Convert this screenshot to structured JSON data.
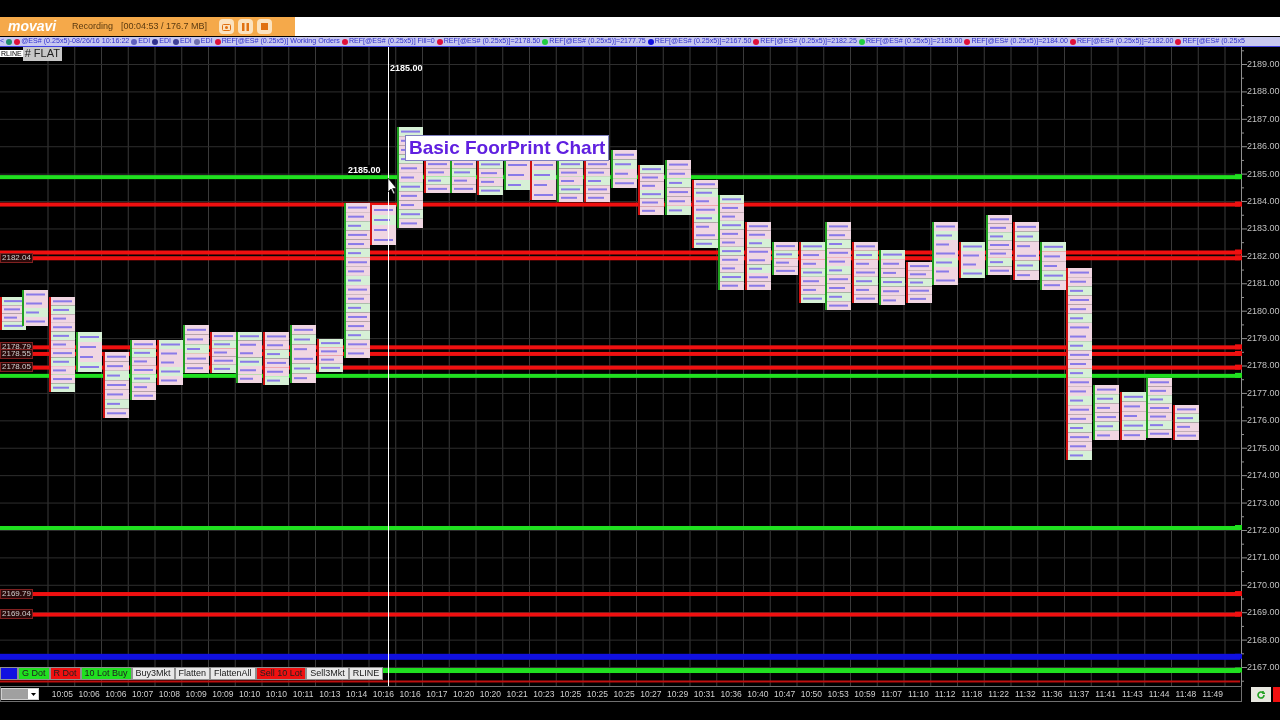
{
  "recorder": {
    "logo": "movavi",
    "status": "Recording",
    "timer": "[00:04:53 / 176.7 MB]"
  },
  "status_strip": {
    "items": [
      {
        "text": "<"
      },
      {
        "color": "#1f8f6f"
      },
      {
        "text": "@ES# (0.25x5)-08/26/16 10:16:22",
        "color": "#e0103a"
      },
      {
        "text": "EDI",
        "color": "#6060c0"
      },
      {
        "text": "EDI",
        "color": "#303090"
      },
      {
        "text": "EDI",
        "color": "#404098"
      },
      {
        "text": "EDI",
        "color": "#7070b0"
      },
      {
        "text": "REF[@ES# (0.25x5)] Working Orders",
        "color": "#e0103a"
      },
      {
        "text": "REF[@ES# (0.25x5)] Fill=0",
        "color": "#e0103a"
      },
      {
        "text": "REF[@ES# (0.25x5)]=2178.50",
        "color": "#e0103a"
      },
      {
        "text": "REF[@ES# (0.25x5)]=2177.75",
        "color": "#20d040"
      },
      {
        "text": "REF[@ES# (0.25x5)]=2167.50",
        "color": "#1010e0"
      },
      {
        "text": "REF[@ES# (0.25x5)]=2182.25",
        "color": "#e0103a"
      },
      {
        "text": "REF[@ES# (0.25x5)]=2185.00",
        "color": "#20d040"
      },
      {
        "text": "REF[@ES# (0.25x5)]=2184.00",
        "color": "#e0103a"
      },
      {
        "text": "REF[@ES# (0.25x5)]=2182.00",
        "color": "#e0103a"
      },
      {
        "text": "REF[@ES# (0.25x5",
        "color": "#e0103a"
      }
    ]
  },
  "chart": {
    "mode_labels": [
      "RLINE",
      "# FLAT"
    ],
    "title": "Basic FoorPrint Chart",
    "crosshair_labels": [
      "2185.00",
      "2185.00"
    ],
    "level_labels": [
      "2182.04",
      "2178.79",
      "2178.55",
      "2178.05",
      "2169.79",
      "2169.04"
    ],
    "price_axis": [
      "2189.00",
      "2188.00",
      "2187.00",
      "2186.00",
      "2185.00",
      "2184.00",
      "2183.00",
      "2182.00",
      "2181.00",
      "2180.00",
      "2179.00",
      "2178.00",
      "2177.00",
      "2176.00",
      "2175.00",
      "2174.00",
      "2173.00",
      "2172.00",
      "2171.00",
      "2170.00",
      "2169.00",
      "2168.00",
      "2167.00"
    ],
    "time_axis": [
      "10:05",
      "10:06",
      "10:06",
      "10:07",
      "10:08",
      "10:09",
      "10:09",
      "10:10",
      "10:10",
      "10:11",
      "10:13",
      "10:14",
      "10:16",
      "10:16",
      "10:17",
      "10:20",
      "10:20",
      "10:21",
      "10:23",
      "10:25",
      "10:25",
      "10:25",
      "10:27",
      "10:29",
      "10:31",
      "10:36",
      "10:40",
      "10:47",
      "10:50",
      "10:53",
      "10:59",
      "11:07",
      "11:10",
      "11:12",
      "11:18",
      "11:22",
      "11:32",
      "11:36",
      "11:37",
      "11:41",
      "11:43",
      "11:44",
      "11:48",
      "11:49"
    ]
  },
  "order_buttons": [
    {
      "color": "#1010e0"
    },
    {
      "label": "G Dot",
      "color": "#20e020"
    },
    {
      "label": "R Dot",
      "color": "#f01010"
    },
    {
      "label": "10 Lot Buy",
      "color": "#20e020"
    },
    {
      "label": "Buy3Mkt",
      "color": "#e8e8e8"
    },
    {
      "label": "Flatten",
      "color": "#e8e8e8"
    },
    {
      "label": "FlattenAll",
      "color": "#e8e8e8"
    },
    {
      "label": "Sell 10 Lot",
      "color": "#f01010"
    },
    {
      "label": "Sell3Mkt",
      "color": "#e8e8e8"
    },
    {
      "label": "RLINE",
      "color": "#e8e8e8"
    }
  ]
}
